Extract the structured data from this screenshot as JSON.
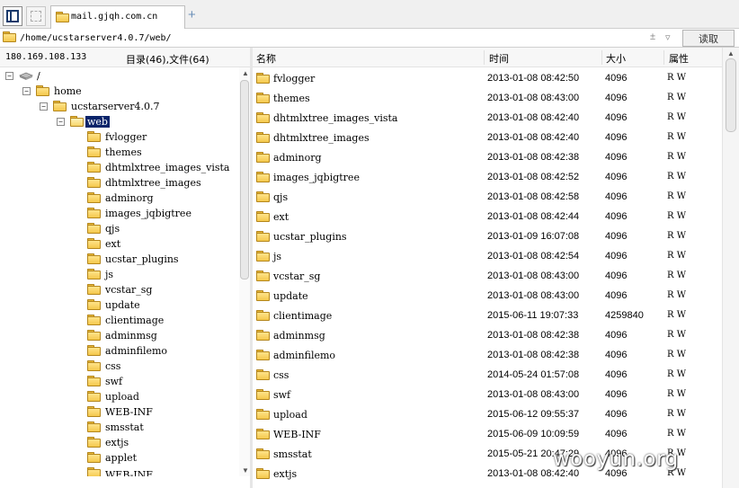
{
  "tab": {
    "label": "mail.gjqh.com.cn",
    "add_label": "+"
  },
  "address": {
    "path": "/home/ucstarserver4.0.7/web/",
    "plus_label": "±",
    "down_label": "▿",
    "read_label": "读取"
  },
  "left_header": {
    "ip": "180.169.108.133",
    "counts": "目录(46),文件(64)"
  },
  "tree": {
    "root": "/",
    "home": "home",
    "server": "ucstarserver4.0.7",
    "web": "web",
    "children": [
      "fvlogger",
      "themes",
      "dhtmlxtree_images_vista",
      "dhtmlxtree_images",
      "adminorg",
      "images_jqbigtree",
      "qjs",
      "ext",
      "ucstar_plugins",
      "js",
      "vcstar_sg",
      "update",
      "clientimage",
      "adminmsg",
      "adminfilemo",
      "css",
      "swf",
      "upload",
      "WEB-INF",
      "smsstat",
      "extjs",
      "applet",
      "WEB-INF、"
    ]
  },
  "columns": {
    "name": "名称",
    "time": "时间",
    "size": "大小",
    "attr": "属性"
  },
  "rows": [
    {
      "name": "fvlogger",
      "time": "2013-01-08 08:42:50",
      "size": "4096",
      "attr": "R W"
    },
    {
      "name": "themes",
      "time": "2013-01-08 08:43:00",
      "size": "4096",
      "attr": "R W"
    },
    {
      "name": "dhtmlxtree_images_vista",
      "time": "2013-01-08 08:42:40",
      "size": "4096",
      "attr": "R W"
    },
    {
      "name": "dhtmlxtree_images",
      "time": "2013-01-08 08:42:40",
      "size": "4096",
      "attr": "R W"
    },
    {
      "name": "adminorg",
      "time": "2013-01-08 08:42:38",
      "size": "4096",
      "attr": "R W"
    },
    {
      "name": "images_jqbigtree",
      "time": "2013-01-08 08:42:52",
      "size": "4096",
      "attr": "R W"
    },
    {
      "name": "qjs",
      "time": "2013-01-08 08:42:58",
      "size": "4096",
      "attr": "R W"
    },
    {
      "name": "ext",
      "time": "2013-01-08 08:42:44",
      "size": "4096",
      "attr": "R W"
    },
    {
      "name": "ucstar_plugins",
      "time": "2013-01-09 16:07:08",
      "size": "4096",
      "attr": "R W"
    },
    {
      "name": "js",
      "time": "2013-01-08 08:42:54",
      "size": "4096",
      "attr": "R W"
    },
    {
      "name": "vcstar_sg",
      "time": "2013-01-08 08:43:00",
      "size": "4096",
      "attr": "R W"
    },
    {
      "name": "update",
      "time": "2013-01-08 08:43:00",
      "size": "4096",
      "attr": "R W"
    },
    {
      "name": "clientimage",
      "time": "2015-06-11 19:07:33",
      "size": "4259840",
      "attr": "R W"
    },
    {
      "name": "adminmsg",
      "time": "2013-01-08 08:42:38",
      "size": "4096",
      "attr": "R W"
    },
    {
      "name": "adminfilemo",
      "time": "2013-01-08 08:42:38",
      "size": "4096",
      "attr": "R W"
    },
    {
      "name": "css",
      "time": "2014-05-24 01:57:08",
      "size": "4096",
      "attr": "R W"
    },
    {
      "name": "swf",
      "time": "2013-01-08 08:43:00",
      "size": "4096",
      "attr": "R W"
    },
    {
      "name": "upload",
      "time": "2015-06-12 09:55:37",
      "size": "4096",
      "attr": "R W"
    },
    {
      "name": "WEB-INF",
      "time": "2015-06-09 10:09:59",
      "size": "4096",
      "attr": "R W"
    },
    {
      "name": "smsstat",
      "time": "2015-05-21 20:47:29",
      "size": "4096",
      "attr": "R W"
    },
    {
      "name": "extjs",
      "time": "2013-01-08 08:42:40",
      "size": "4096",
      "attr": "R W"
    }
  ],
  "watermark": "wooyun.org"
}
